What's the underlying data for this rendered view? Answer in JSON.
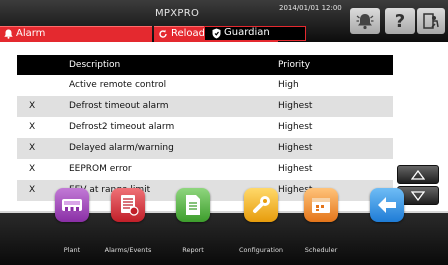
{
  "header": {
    "title": "MPXPRO",
    "datetime": "2014/01/01  12:00"
  },
  "tabs": [
    {
      "label": "Alarm"
    },
    {
      "label": "Reload"
    },
    {
      "label": "Guardian"
    }
  ],
  "table": {
    "columns": [
      "Description",
      "Priority"
    ],
    "rows": [
      {
        "mark": "",
        "description": "Active remote control",
        "priority": "High"
      },
      {
        "mark": "X",
        "description": "Defrost timeout alarm",
        "priority": "Highest"
      },
      {
        "mark": "X",
        "description": "Defrost2 timeout alarm",
        "priority": "Highest"
      },
      {
        "mark": "X",
        "description": "Delayed alarm/warning",
        "priority": "Highest"
      },
      {
        "mark": "X",
        "description": "EEPROM error",
        "priority": "Highest"
      },
      {
        "mark": "X",
        "description": "EEV at range limit",
        "priority": "Highest"
      }
    ]
  },
  "nav": [
    {
      "label": "Plant",
      "icon": "plant-icon",
      "color": "#9b3fb5"
    },
    {
      "label": "Alarms/Events",
      "icon": "alarms-icon",
      "color": "#d2333c"
    },
    {
      "label": "Report",
      "icon": "report-icon",
      "color": "#4cae3a"
    },
    {
      "label": "Configuration",
      "icon": "configuration-icon",
      "color": "#f0b21f"
    },
    {
      "label": "Scheduler",
      "icon": "scheduler-icon",
      "color": "#f08a1c"
    },
    {
      "label": "",
      "icon": "back-arrow-icon",
      "color": "#2c8fe0"
    }
  ],
  "colors": {
    "accent_red": "#e4292f",
    "header_bg": "#1c1c1c",
    "row_alt": "#e0e0e0"
  }
}
